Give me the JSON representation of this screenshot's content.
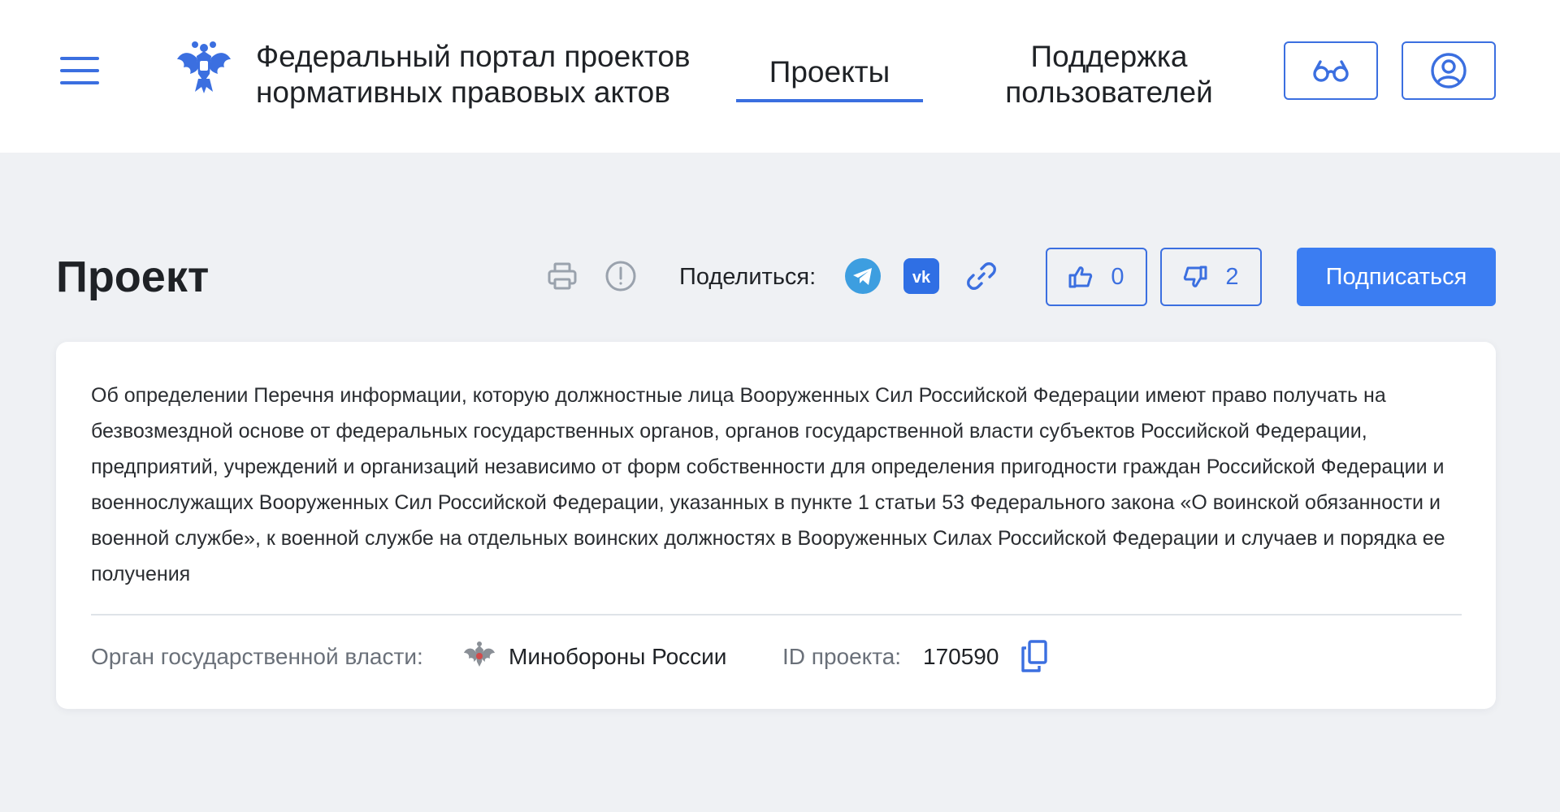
{
  "header": {
    "menu_icon": "hamburger-menu-icon",
    "emblem_icon": "russian-coat-of-arms-emblem",
    "portal_title_line1": "Федеральный портал проектов",
    "portal_title_line2": "нормативных правовых актов",
    "nav": {
      "projects": "Проекты",
      "support_line1": "Поддержка",
      "support_line2": "пользователей"
    },
    "accessibility_icon": "glasses-icon",
    "profile_icon": "user-profile-icon"
  },
  "title_row": {
    "page_title": "Проект",
    "print_icon": "printer-icon",
    "report_icon": "exclamation-circle-icon",
    "share_label": "Поделиться:",
    "share_icons": [
      "telegram-icon",
      "vk-icon",
      "link-icon"
    ],
    "likes": "0",
    "dislikes": "2",
    "subscribe_label": "Подписаться"
  },
  "project": {
    "description": "Об определении Перечня информации, которую должностные лица Вооруженных Сил Российской Федерации имеют право получать на безвозмездной основе от федеральных государственных органов, органов государственной власти субъектов Российской Федерации, предприятий, учреждений и организаций независимо от форм собственности для определения пригодности граждан Российской Федерации и военнослужащих Вооруженных Сил Российской Федерации, указанных в пункте 1 статьи 53 Федерального закона «О воинской обязанности и военной службе», к военной службе на отдельных воинских должностях в Вооруженных Силах Российской Федерации и случаев и порядка ее получения",
    "org_label": "Орган государственной власти:",
    "org_name": "Минобороны России",
    "id_label": "ID проекта:",
    "id_value": "170590"
  },
  "colors": {
    "accent": "#3b6fe0",
    "button_primary": "#3b7df2",
    "page_background": "#eff1f4",
    "telegram": "#3d9ee0",
    "vk": "#2f6fe4"
  }
}
